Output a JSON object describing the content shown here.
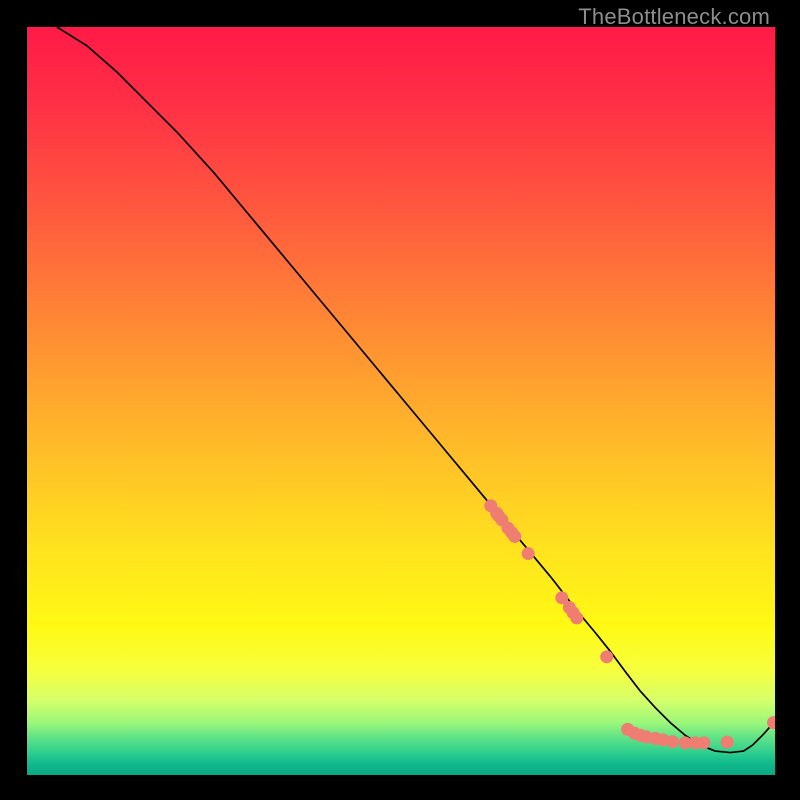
{
  "watermark": "TheBottleneck.com",
  "colors": {
    "curve": "#000000",
    "dot": "#ef7d71",
    "frame": "#000000"
  },
  "chart_data": {
    "type": "line",
    "title": "",
    "xlabel": "",
    "ylabel": "",
    "xlim": [
      0,
      100
    ],
    "ylim": [
      0,
      100
    ],
    "grid": false,
    "legend": false,
    "series": [
      {
        "name": "bottleneck-curve",
        "x": [
          4,
          8,
          12,
          16,
          20,
          25,
          30,
          35,
          40,
          45,
          50,
          55,
          60,
          65,
          70,
          73.5,
          76,
          78,
          80,
          82,
          84,
          86,
          88,
          90,
          92,
          94,
          95.8,
          97,
          98.5,
          100
        ],
        "y": [
          100,
          97.5,
          94,
          90,
          86,
          80.5,
          74.5,
          68.5,
          62.5,
          56.5,
          50.5,
          44.5,
          38.5,
          32.5,
          26.5,
          22,
          19,
          16.5,
          13.8,
          11.2,
          9,
          7,
          5.3,
          4,
          3.2,
          3,
          3.2,
          4,
          5.5,
          7.2
        ]
      }
    ],
    "scatter_points": {
      "name": "markers",
      "points": [
        {
          "x": 62.0,
          "y": 36.0
        },
        {
          "x": 62.8,
          "y": 35.0
        },
        {
          "x": 63.0,
          "y": 34.7
        },
        {
          "x": 63.5,
          "y": 34.1
        },
        {
          "x": 64.3,
          "y": 33.0
        },
        {
          "x": 64.8,
          "y": 32.4
        },
        {
          "x": 65.2,
          "y": 31.9
        },
        {
          "x": 67.0,
          "y": 29.6
        },
        {
          "x": 71.5,
          "y": 23.7
        },
        {
          "x": 72.5,
          "y": 22.4
        },
        {
          "x": 73.0,
          "y": 21.7
        },
        {
          "x": 73.5,
          "y": 21.0
        },
        {
          "x": 77.5,
          "y": 15.8
        },
        {
          "x": 80.3,
          "y": 6.1
        },
        {
          "x": 81.2,
          "y": 5.6
        },
        {
          "x": 82.0,
          "y": 5.3
        },
        {
          "x": 82.8,
          "y": 5.1
        },
        {
          "x": 84.0,
          "y": 4.9
        },
        {
          "x": 85.0,
          "y": 4.7
        },
        {
          "x": 86.3,
          "y": 4.45
        },
        {
          "x": 88.0,
          "y": 4.3
        },
        {
          "x": 89.3,
          "y": 4.3
        },
        {
          "x": 90.5,
          "y": 4.3
        },
        {
          "x": 93.6,
          "y": 4.4
        },
        {
          "x": 99.8,
          "y": 7.0
        }
      ]
    }
  }
}
